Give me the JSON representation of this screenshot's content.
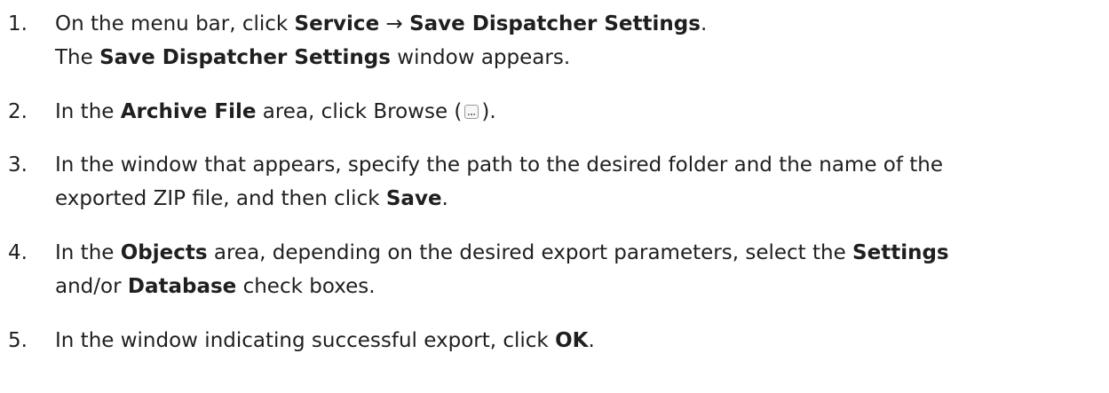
{
  "steps": [
    {
      "number": "1.",
      "lines": [
        {
          "t0": "On the menu bar, click ",
          "b0": "Service",
          "t1": " → ",
          "b1": "Save Dispatcher Settings",
          "t2": "."
        },
        {
          "t0": "The ",
          "b0": "Save Dispatcher Settings",
          "t1": " window appears."
        }
      ]
    },
    {
      "number": "2.",
      "lines": [
        {
          "t0": "In the ",
          "b0": "Archive File",
          "t1": " area, click Browse (",
          "icon": "browse-icon",
          "t2": ")."
        }
      ]
    },
    {
      "number": "3.",
      "lines": [
        {
          "t0": "In the window that appears, specify the path to the desired folder and the name of the"
        },
        {
          "t0": "exported ZIP file, and then click ",
          "b0": "Save",
          "t1": "."
        }
      ]
    },
    {
      "number": "4.",
      "lines": [
        {
          "t0": "In the ",
          "b0": "Objects",
          "t1": " area, depending on the desired export parameters, select the ",
          "b1": "Settings"
        },
        {
          "t0": "and/or ",
          "b0": "Database",
          "t1": " check boxes."
        }
      ]
    },
    {
      "number": "5.",
      "lines": [
        {
          "t0": "In the window indicating successful export, click ",
          "b0": "OK",
          "t1": "."
        }
      ]
    }
  ]
}
